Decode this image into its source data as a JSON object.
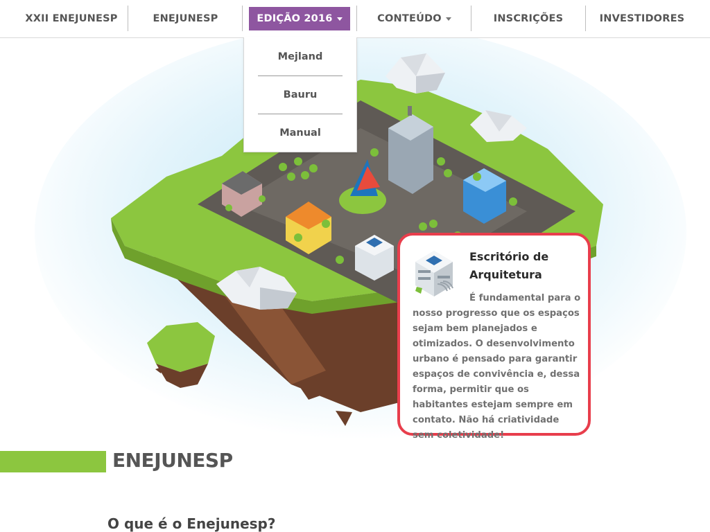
{
  "nav": {
    "items": [
      {
        "label": "XXII ENEJUNESP"
      },
      {
        "label": "ENEJUNESP"
      },
      {
        "label": "EDIÇÃO 2016"
      },
      {
        "label": "CONTEÚDO"
      },
      {
        "label": "INSCRIÇÕES"
      },
      {
        "label": "INVESTIDORES"
      }
    ],
    "active_color": "#8e56a0"
  },
  "dropdown": {
    "items": [
      {
        "label": "Mejland"
      },
      {
        "label": "Bauru"
      },
      {
        "label": "Manual"
      }
    ]
  },
  "card": {
    "title": "Escritório de Arquitetura",
    "text": "É fundamental para o nosso progresso que os espaços sejam bem planejados e otimizados. O desenvolvimento urbano é pensado para garantir espaços de convivência e, dessa forma, permitir que os habitantes estejam sempre em contato. Não há criatividade sem coletividade!",
    "border_color": "#e83e4c",
    "icon": "office-building-icon"
  },
  "section": {
    "title": "ENEJUNESP",
    "subtitle": "O que é o Enejunesp?",
    "accent_color": "#8cc63f"
  }
}
